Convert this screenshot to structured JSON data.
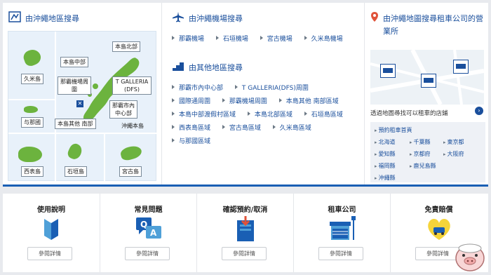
{
  "map_section": {
    "title": "由沖繩地區搜尋",
    "labels": {
      "kume": "久米島",
      "aguni": "与那國",
      "nishiomote": "西表島",
      "ishigaki": "石垣島",
      "miyako": "宮古島",
      "honto_north": "本島北部",
      "honto_central": "本島中部",
      "naha_airport": "那霸機場周圍",
      "galleria": "T GALLERIA (DFS)",
      "naha_center": "那霸市內中心部",
      "honto_south": "本島其他 南部",
      "okinawa_main": "沖繩本島"
    }
  },
  "airport_section": {
    "title": "由沖繩機場搜尋",
    "links": [
      "那霸機場",
      "石垣機場",
      "宮古機場",
      "久米島機場"
    ]
  },
  "other_section": {
    "title": "由其他地區搜尋",
    "rows": [
      [
        "那霸市內中心部",
        "T GALLERIA(DFS)周圍"
      ],
      [
        "國際通周圍",
        "那霸機場周圍",
        "本島其他 南部區域"
      ],
      [
        "本島中部渡假村區域",
        "本島北部區域",
        "石垣島區域"
      ],
      [
        "西表島區域",
        "宮古島區域",
        "久米島區域"
      ],
      [
        "与那國區域"
      ]
    ]
  },
  "rental_section": {
    "title_line1": "由沖繩地圖搜尋租車公司的營",
    "title_line2": "業所",
    "caption": "透過地圖尋找可以租車的店鋪",
    "links": [
      "預約租車首頁",
      "北海道",
      "千葉縣",
      "東京都",
      "愛知縣",
      "京都府",
      "大阪府",
      "福岡縣",
      "鹿兒島縣",
      "沖繩縣"
    ]
  },
  "tiles": [
    {
      "title": "使用說明",
      "button": "參閱詳情",
      "icon": "beginner-mark-icon"
    },
    {
      "title": "常見問題",
      "button": "參閱詳情",
      "icon": "qa-bubble-icon"
    },
    {
      "title": "確認預約/取消",
      "button": "參閱詳情",
      "icon": "reservation-book-icon"
    },
    {
      "title": "租車公司",
      "button": "參閱詳情",
      "icon": "rental-shop-icon"
    },
    {
      "title": "免責賠償",
      "button": "參閱詳情",
      "icon": "insurance-heart-icon"
    }
  ],
  "colors": {
    "brand": "#1a4f9c",
    "island": "#6cb33e",
    "accent": "#1a5fb4"
  }
}
